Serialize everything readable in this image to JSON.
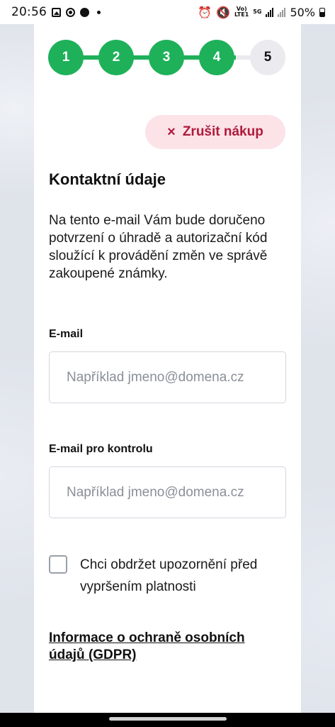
{
  "status_bar": {
    "time": "20:56",
    "network_top": "Vo)",
    "network_bottom": "LTE1",
    "gen": "5G",
    "battery": "50%"
  },
  "stepper": {
    "steps": [
      {
        "label": "1",
        "state": "done"
      },
      {
        "label": "2",
        "state": "done"
      },
      {
        "label": "3",
        "state": "done"
      },
      {
        "label": "4",
        "state": "done"
      },
      {
        "label": "5",
        "state": "current"
      }
    ],
    "done_color": "#1eb15a",
    "todo_color": "#ebebef"
  },
  "cancel": {
    "icon": "×",
    "label": "Zrušit nákup"
  },
  "section": {
    "title": "Kontaktní údaje",
    "description": "Na tento e-mail Vám bude doručeno potvrzení o úhradě a autorizační kód sloužící k provádění změn ve správě zakoupené známky."
  },
  "email": {
    "label": "E-mail",
    "value": "",
    "placeholder": "Například jmeno@domena.cz"
  },
  "email_confirm": {
    "label": "E-mail pro kontrolu",
    "value": "",
    "placeholder": "Například jmeno@domena.cz"
  },
  "notify": {
    "checked": false,
    "label": "Chci obdržet upozornění před vypršením platnosti"
  },
  "gdpr_link": "Informace o ochraně osobních údajů (GDPR)",
  "colors": {
    "accent_green": "#1eb15a",
    "cancel_bg": "#fbe3e8",
    "cancel_text": "#b01a3a"
  }
}
